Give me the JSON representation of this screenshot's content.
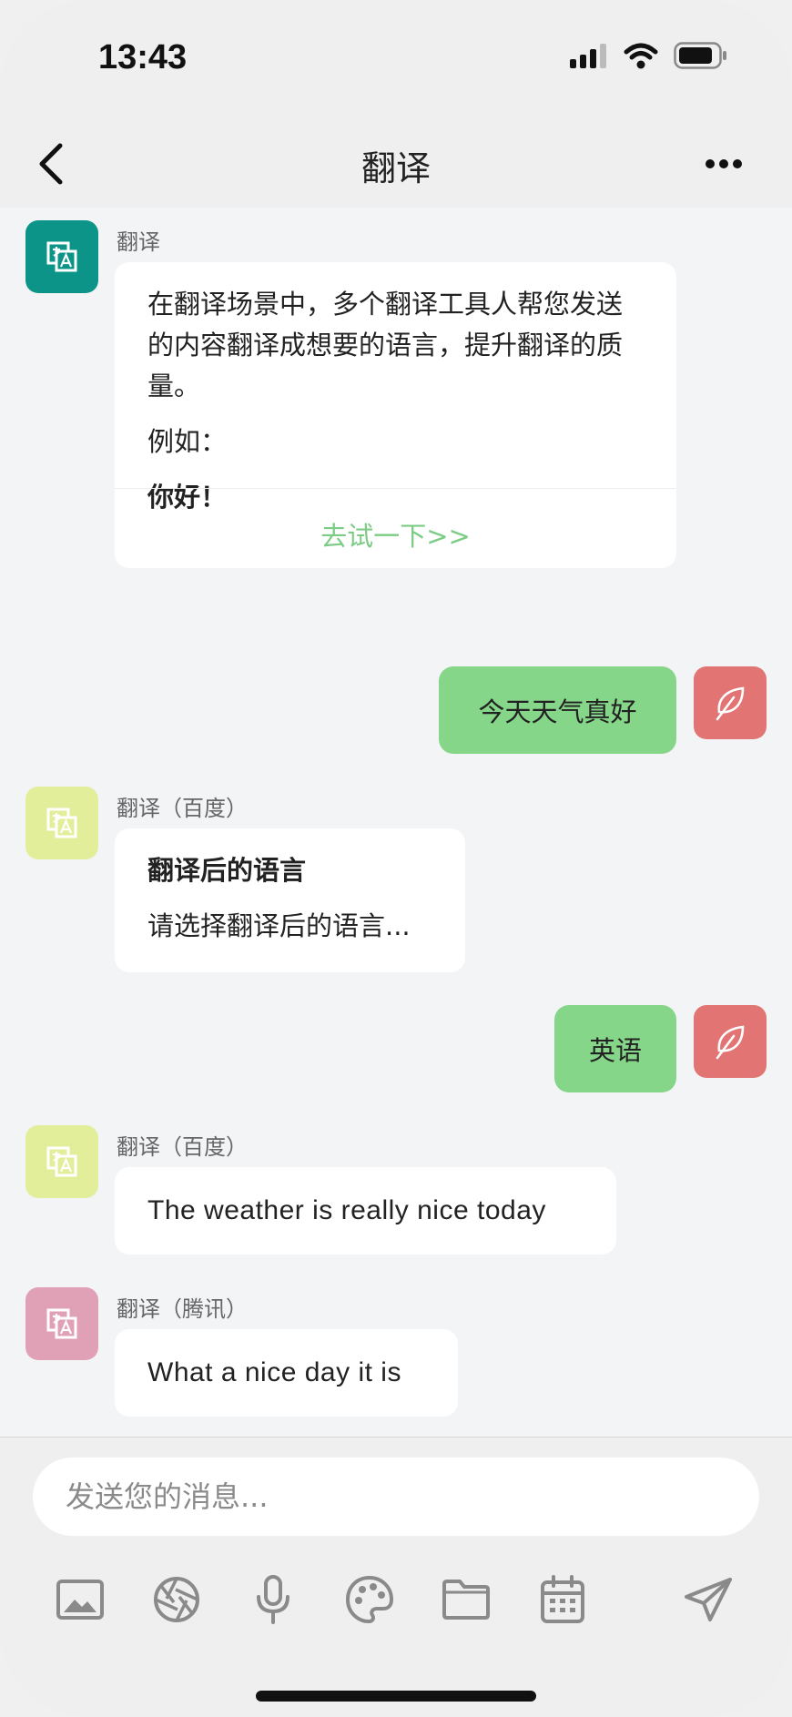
{
  "status": {
    "time": "13:43"
  },
  "nav": {
    "title": "翻译"
  },
  "messages": {
    "m1": {
      "sender": "翻译",
      "avatar_color": "#0d9488",
      "intro": "在翻译场景中，多个翻译工具人帮您发送的内容翻译成想要的语言，提升翻译的质量。",
      "example_label": "例如：",
      "example_text": "你好！",
      "try_link": "去试一下>>"
    },
    "m2": {
      "text": "今天天气真好"
    },
    "m3": {
      "sender": "翻译（百度）",
      "avatar_color": "#e3ee9a",
      "title": "翻译后的语言",
      "body": "请选择翻译后的语言..."
    },
    "m4": {
      "text": "英语"
    },
    "m5": {
      "sender": "翻译（百度）",
      "avatar_color": "#e3ee9a",
      "text": "The weather is really nice today"
    },
    "m6": {
      "sender": "翻译（腾讯）",
      "avatar_color": "#e0a0b6",
      "text": "What a nice day it is"
    }
  },
  "user_avatar_color": "#e37474",
  "accent_green": "#86d68a",
  "link_green": "#7ccc85",
  "input": {
    "placeholder": "发送您的消息..."
  },
  "toolbar": {
    "icons": [
      "image-icon",
      "aperture-icon",
      "microphone-icon",
      "palette-icon",
      "folder-icon",
      "calendar-icon",
      "send-icon"
    ]
  }
}
